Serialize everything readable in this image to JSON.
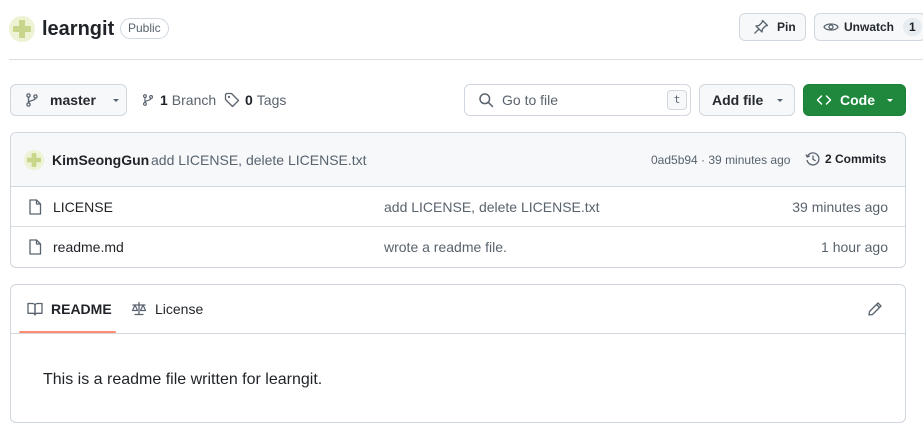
{
  "header": {
    "repo_name": "learngit",
    "visibility": "Public",
    "pin_label": "Pin",
    "watch_label": "Unwatch",
    "watch_count": "1"
  },
  "toolbar": {
    "branch_name": "master",
    "branch_count": "1",
    "branch_label": "Branch",
    "tag_count": "0",
    "tag_label": "Tags",
    "search_placeholder": "Go to file",
    "search_shortcut": "t",
    "add_file_label": "Add file",
    "code_label": "Code"
  },
  "latest_commit": {
    "author": "KimSeongGun",
    "message": "add LICENSE, delete LICENSE.txt",
    "meta": "0ad5b94 · 39 minutes ago",
    "commits_label": "2 Commits"
  },
  "files": [
    {
      "name": "LICENSE",
      "message": "add LICENSE, delete LICENSE.txt",
      "time": "39 minutes ago"
    },
    {
      "name": "readme.md",
      "message": "wrote a readme file.",
      "time": "1 hour ago"
    }
  ],
  "readme": {
    "tabs": [
      {
        "label": "README"
      },
      {
        "label": "License"
      }
    ],
    "body": "This is a readme file written for learngit."
  },
  "colors": {
    "code_button": "#1f883d",
    "active_tab_underline": "#fd8c73",
    "border": "#d0d7de",
    "muted_text": "#59636e"
  },
  "icons": [
    "identicon-avatar",
    "pin-icon",
    "eye-icon",
    "git-branch-icon",
    "tag-icon",
    "search-icon",
    "caret-down-icon",
    "code-icon",
    "history-icon",
    "file-icon",
    "book-icon",
    "law-icon",
    "pencil-icon"
  ]
}
